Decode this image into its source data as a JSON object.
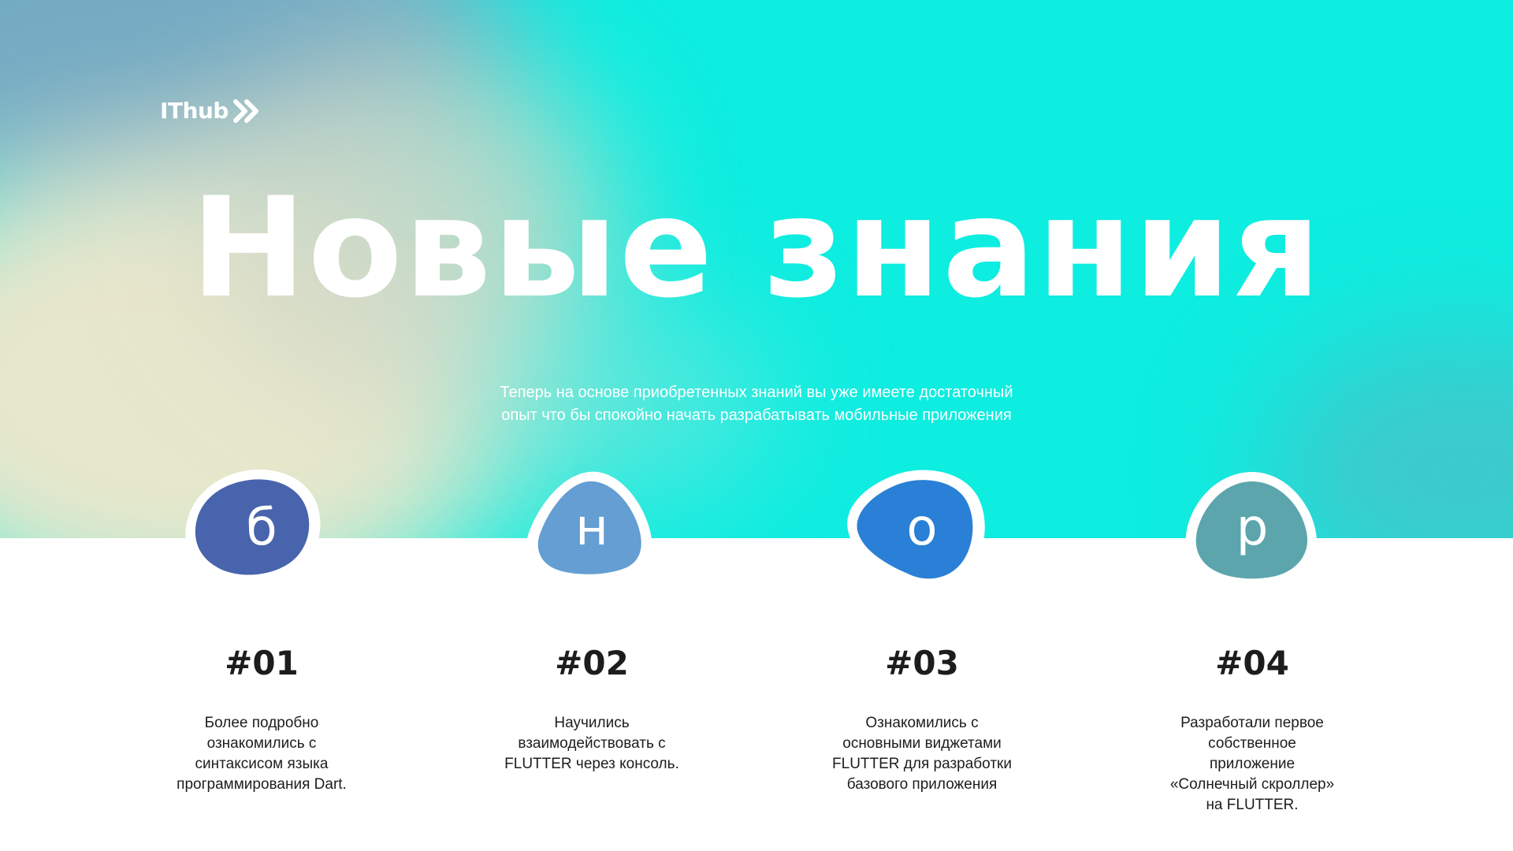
{
  "logo": {
    "text": "IThub",
    "icon": "double-chevron-right-icon"
  },
  "hero": {
    "title": "Новые знания",
    "subtitle_line1": "Теперь на основе приобретенных знаний вы уже имеете достаточный",
    "subtitle_line2": "опыт что бы спокойно начать разрабатывать мобильные приложения"
  },
  "colors": {
    "hero_background": "#0dede0",
    "text_dark": "#1d1d1f",
    "badge_1": "#4864ac",
    "badge_2": "#649ed2",
    "badge_3": "#2a80d6",
    "badge_4": "#5ca5ad"
  },
  "features": [
    {
      "letter": "б",
      "number": "#01",
      "text": "Более подробно\nознакомились с\nсинтаксисом языка\nпрограммирования Dart."
    },
    {
      "letter": "н",
      "number": "#02",
      "text": "Научились\nвзаимодействовать с\nFLUTTER через консоль."
    },
    {
      "letter": "о",
      "number": "#03",
      "text": "Ознакомились с\nосновными виджетами\nFLUTTER для разработки\nбазового приложения"
    },
    {
      "letter": "р",
      "number": "#04",
      "text": "Разработали первое\nсобственное\nприложение\n«Солнечный скроллер»\nна FLUTTER."
    }
  ]
}
